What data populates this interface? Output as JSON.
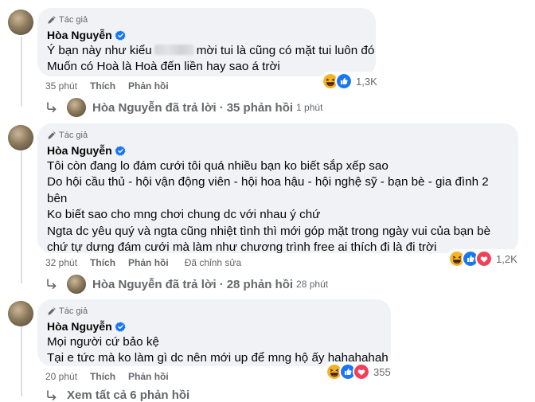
{
  "comments": [
    {
      "author_badge": "Tác giả",
      "author": "Hòa Nguyễn",
      "text_l1_pre": "Ý bạn này như kiểu",
      "text_l1_post": "mời tui là cũng có mặt tui luôn đó",
      "text_l2": "Muốn có Hoà là Hoà đến liền hay sao á trời",
      "time": "35 phút",
      "like": "Thích",
      "reply": "Phản hồi",
      "reaction_count": "1,3K",
      "reactions": [
        "haha-icon",
        "like-icon"
      ],
      "replies_by": "Hòa Nguyễn đã trả lời",
      "replies_count": "35 phản hồi",
      "replies_time": "1 phút"
    },
    {
      "author_badge": "Tác giả",
      "author": "Hòa Nguyễn",
      "lines": [
        "Tôi còn đang lo đám cưới tôi quá nhiều bạn ko biết sắp xếp sao",
        "Do hội cầu thủ - hội vận động viên - hội hoa hậu - hội nghệ sỹ - bạn bè - gia đình 2",
        "bên",
        "Ko biết sao cho mng chơi chung dc với nhau ý chứ",
        "Ngta dc yêu quý và ngta cũng nhiệt tình thì mới góp mặt trong ngày vui của bạn bè",
        "chứ tự dưng đám cưới mà làm như chương trình free ai thích đi là đi trời"
      ],
      "time": "32 phút",
      "like": "Thích",
      "reply": "Phản hồi",
      "edited": "Đã chỉnh sửa",
      "reaction_count": "1,2K",
      "reactions": [
        "haha-icon",
        "like-icon",
        "love-icon"
      ],
      "replies_by": "Hòa Nguyễn đã trả lời",
      "replies_count": "28 phản hồi",
      "replies_time": "28 phút"
    },
    {
      "author_badge": "Tác giả",
      "author": "Hòa Nguyễn",
      "lines": [
        "Mọi người cứ bảo kệ",
        "Tại e tức mà ko làm gì dc nên mới up để mng hộ ấy hahahahah"
      ],
      "time": "20 phút",
      "like": "Thích",
      "reply": "Phản hồi",
      "reaction_count": "355",
      "reactions": [
        "haha-icon",
        "like-icon",
        "love-icon"
      ]
    }
  ],
  "view_all": "Xem tất cả 6 phản hồi",
  "colors": {
    "bubble": "#f0f2f5",
    "secondary_text": "#65676b",
    "verified": "#1877f2",
    "like": "#1877f2",
    "love": "#f33e58",
    "haha": "#f7b125"
  }
}
